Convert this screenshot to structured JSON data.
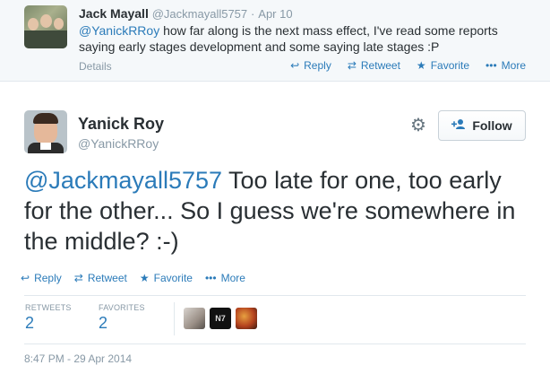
{
  "parent_tweet": {
    "name": "Jack Mayall",
    "handle": "@Jackmayall5757",
    "separator": "·",
    "date": "Apr 10",
    "mention": "@YanickRRoy",
    "text": " how far along is the next mass effect, I've read some reports saying early stages development and some saying late stages :P",
    "details_label": "Details",
    "actions": {
      "reply": "Reply",
      "retweet": "Retweet",
      "favorite": "Favorite",
      "more": "More"
    }
  },
  "main_tweet": {
    "name": "Yanick Roy",
    "handle": "@YanickRRoy",
    "follow_label": "Follow",
    "mention": "@Jackmayall5757",
    "text": " Too late for one, too early for the other... So I guess we're somewhere in the middle? :-)",
    "actions": {
      "reply": "Reply",
      "retweet": "Retweet",
      "favorite": "Favorite",
      "more": "More"
    },
    "stats": {
      "retweets_label": "RETWEETS",
      "retweets_count": "2",
      "favorites_label": "FAVORITES",
      "favorites_count": "2"
    },
    "favoriter_avatar_2_text": "N7",
    "timestamp": "8:47 PM - 29 Apr 2014"
  },
  "icons": {
    "reply": "↩",
    "retweet": "⇄",
    "favorite": "★",
    "more": "•••",
    "gear": "⚙",
    "follow": "+👤"
  },
  "colors": {
    "link": "#2b7bb9",
    "muted": "#8899a6",
    "text": "#292f33",
    "parent_bg": "#f5f8fa"
  }
}
